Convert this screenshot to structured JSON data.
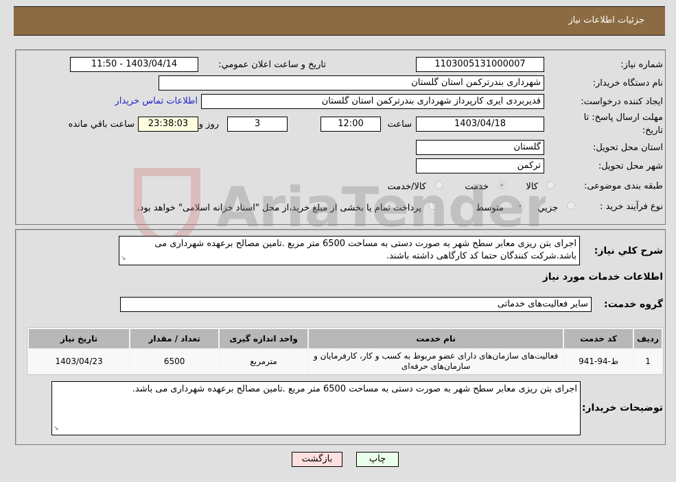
{
  "header": {
    "title": "جزئیات اطلاعات نیاز"
  },
  "details": {
    "need_number_label": "شماره نیاز:",
    "need_number": "1103005131000007",
    "announce_label": "تاریخ و ساعت اعلان عمومي:",
    "announce_value": "1403/04/14 - 11:50",
    "buyer_org_label": "نام دستگاه خریدار:",
    "buyer_org": "شهرداری بندرترکمن استان گلستان",
    "creator_label": "ایجاد کننده درخواست:",
    "creator": "قدیربردی ایری کارپرداز شهرداری بندرترکمن استان گلستان",
    "contact_link": "اطلاعات تماس خریدار",
    "deadline_label_line1": "مهلت ارسال پاسخ: تا",
    "deadline_label_line2": "تاریخ:",
    "deadline_date": "1403/04/18",
    "time_label": "ساعت",
    "deadline_time": "12:00",
    "days_value": "3",
    "days_label": "روز و",
    "remaining_time": "23:38:03",
    "remaining_label": "ساعت باقي مانده",
    "province_label": "استان محل تحویل:",
    "province": "گلستان",
    "city_label": "شهر محل تحویل:",
    "city": "ترکمن",
    "category_label": "طبقه بندی موضوعی:",
    "category_options": [
      {
        "label": "کالا",
        "selected": false
      },
      {
        "label": "خدمت",
        "selected": true
      },
      {
        "label": "کالا/خدمت",
        "selected": false
      }
    ],
    "process_label": "نوع فرآیند خرید :",
    "process_options": [
      {
        "label": "جزيي",
        "selected": false
      },
      {
        "label": "متوسط",
        "selected": true
      }
    ],
    "treasury_checkbox_label": "پرداخت تمام یا بخشی از مبلغ خرید،از محل \"اسناد خزانه اسلامی\" خواهد بود.",
    "treasury_checked": false
  },
  "summary": {
    "label": "شرح کلي نياز:",
    "text": "اجرای بتن ریزی معابر سطح شهر به صورت دستی به مساحت 6500 متر مربع .تامین مصالح برعهده شهرداری می باشد.شرکت کنندگان حتما کد کارگاهی داشته باشند."
  },
  "services": {
    "section_title": "اطلاعات خدمات مورد نياز",
    "group_label": "گروه خدمت:",
    "group_value": "سایر فعالیت‌های خدماتی",
    "table": {
      "headers": [
        "ردیف",
        "کد خدمت",
        "نام خدمت",
        "واحد اندازه گیری",
        "تعداد / مقدار",
        "تاریخ نیاز"
      ],
      "rows": [
        [
          "1",
          "ط-94-941",
          "فعالیت‌های سازمان‌های دارای عضو مربوط به کسب و کار، کارفرمایان و سازمان‌های حرفه‌ای",
          "مترمربع",
          "6500",
          "1403/04/23"
        ]
      ]
    }
  },
  "buyer_notes": {
    "label": "توضیحات خریدار:",
    "text": "اجرای بتن ریزی معابر سطح شهر به صورت دستی به مساحت 6500 متر مربع .تامین مصالح برعهده شهرداری می باشد."
  },
  "buttons": {
    "print": "چاپ",
    "back": "بازگشت"
  },
  "watermark": {
    "text": "AriaTender.neT"
  },
  "colors": {
    "header_bg": "#8c6b42",
    "link": "#2222cc",
    "back_btn": "#ffe0e0",
    "print_btn": "#eaffea",
    "remaining_bg": "#ffffe0"
  }
}
